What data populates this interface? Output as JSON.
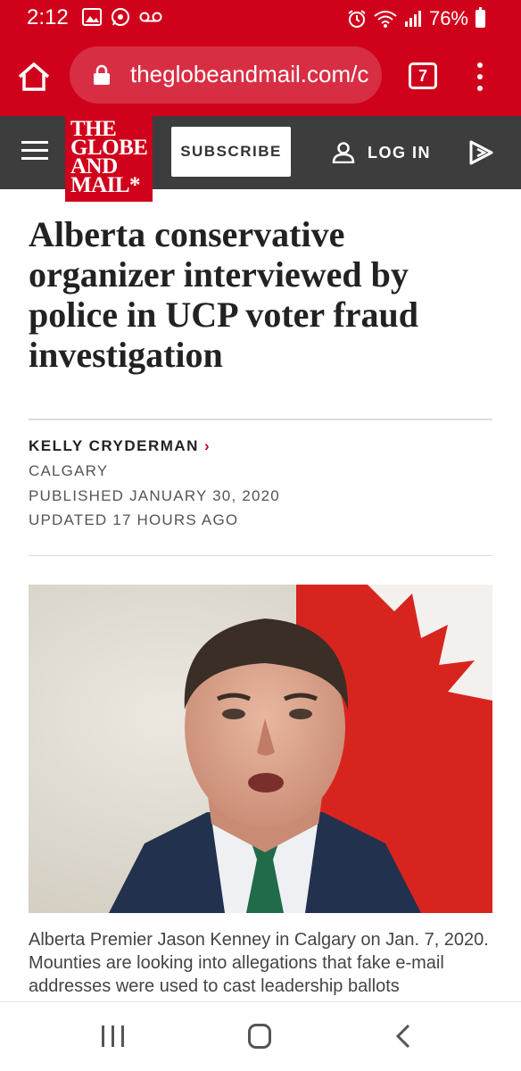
{
  "status_bar": {
    "time": "2:12",
    "battery": "76%",
    "left_icons": [
      "image-icon",
      "whatsapp-icon",
      "voicemail-icon"
    ],
    "right_icons": [
      "alarm-icon",
      "wifi-icon",
      "signal-icon",
      "battery-icon"
    ]
  },
  "browser": {
    "url": "theglobeandmail.com/c",
    "tab_count": "7"
  },
  "site_header": {
    "logo_lines": [
      "THE",
      "GLOBE",
      "AND",
      "MAIL*"
    ],
    "subscribe_label": "SUBSCRIBE",
    "login_label": "LOG IN"
  },
  "article": {
    "headline": "Alberta conservative organizer interviewed by police in UCP voter fraud investigation",
    "author": "KELLY CRYDERMAN",
    "location": "CALGARY",
    "published": "PUBLISHED JANUARY 30, 2020",
    "updated": "UPDATED 17 HOURS AGO",
    "caption": "Alberta Premier Jason Kenney in Calgary on Jan. 7, 2020. Mounties are looking into allegations that fake e-mail addresses were used to cast leadership ballots"
  },
  "colors": {
    "brand_red": "#d0011b",
    "header_gray": "#3d3d3d"
  }
}
